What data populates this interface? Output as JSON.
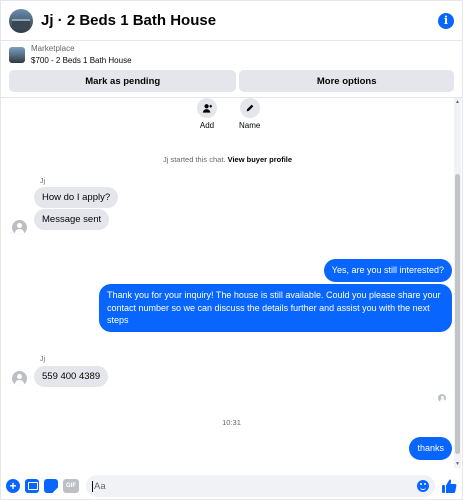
{
  "header": {
    "title": "Jj · 2 Beds 1 Bath House",
    "info_icon": "info-icon"
  },
  "listing": {
    "label": "Marketplace",
    "subtitle": "$700 - 2 Beds 1 Bath House",
    "buttons": {
      "pending": "Mark as pending",
      "more": "More options"
    }
  },
  "quick_actions": [
    {
      "label": "Add",
      "icon": "add-person-icon"
    },
    {
      "label": "Name",
      "icon": "pencil-icon"
    }
  ],
  "chat": {
    "started_text": "Jj started this chat.",
    "view_profile": "View buyer profile",
    "sender_name": "Jj",
    "messages": [
      {
        "from": "buyer",
        "text": "How do I apply?"
      },
      {
        "from": "buyer",
        "text": "Message sent"
      },
      {
        "from": "seller",
        "text": "Yes, are you still interested?"
      },
      {
        "from": "seller",
        "text": "Thank you for your inquiry! The house is still available. Could you please share your contact number so we can discuss the details further and assist you with the next steps"
      },
      {
        "from": "buyer",
        "text": "559 400 4389"
      },
      {
        "from": "seller",
        "text": "thanks"
      }
    ],
    "timestamp": "10:31"
  },
  "composer": {
    "placeholder": "Aa",
    "gif_label": "GIF"
  },
  "colors": {
    "accent": "#0866ff",
    "bubble_in": "#e4e6eb",
    "muted_text": "#65676b"
  }
}
